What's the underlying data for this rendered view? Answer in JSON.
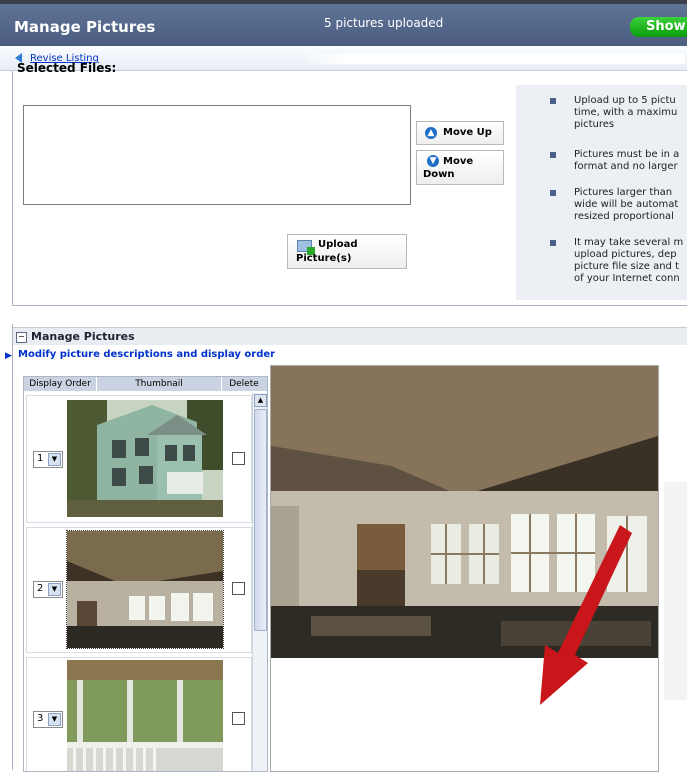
{
  "header": {
    "title": "Manage Pictures",
    "status": "5 pictures uploaded",
    "show_label": "Show"
  },
  "nav": {
    "revise_label": "Revise Listing"
  },
  "upload": {
    "selected_files_label": "Selected Files:",
    "move_up_label": "Move Up",
    "move_down_label": "Move\nDown",
    "upload_label": "Upload\nPicture(s)"
  },
  "tips": [
    "Upload up to 5 pictu\ntime, with a maximu\npictures",
    "Pictures must be in a\nformat and no larger",
    "Pictures larger than\nwide will be automat\nresized proportional",
    "It may take several m\nupload pictures, dep\npicture file size and t\nof your Internet conn"
  ],
  "manage": {
    "title": "Manage Pictures",
    "modify_label": "Modify picture descriptions and display order",
    "columns": [
      "Display Order",
      "Thumbnail",
      "Delete"
    ],
    "rows": [
      {
        "order": "1"
      },
      {
        "order": "2"
      },
      {
        "order": "3"
      }
    ]
  },
  "colors": {
    "header_bg": "#4b5e82",
    "show_button": "#14a314",
    "link": "#0033cc",
    "arrow": "#c8161b"
  },
  "icons": [
    "back-arrow-icon",
    "move-up-icon",
    "move-down-icon",
    "upload-icon",
    "collapse-icon",
    "dropdown-arrow-icon",
    "scroll-up-icon"
  ]
}
